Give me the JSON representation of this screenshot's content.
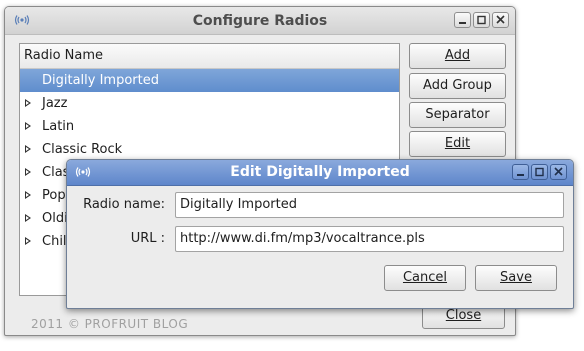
{
  "main_window": {
    "title": "Configure Radios",
    "list_header": "Radio Name",
    "rows": [
      {
        "label": "Digitally Imported",
        "expandable": false,
        "selected": true
      },
      {
        "label": "Jazz",
        "expandable": true,
        "selected": false
      },
      {
        "label": "Latin",
        "expandable": true,
        "selected": false
      },
      {
        "label": "Classic Rock",
        "expandable": true,
        "selected": false
      },
      {
        "label": "Clas",
        "expandable": true,
        "selected": false
      },
      {
        "label": "Pop",
        "expandable": true,
        "selected": false
      },
      {
        "label": "Oldi",
        "expandable": true,
        "selected": false
      },
      {
        "label": "Chil",
        "expandable": true,
        "selected": false
      }
    ],
    "buttons": {
      "add": "Add",
      "add_group": "Add Group",
      "separator": "Separator",
      "edit": "Edit",
      "close": "Close"
    },
    "watermark": "2011 © PROFRUIT BLOG"
  },
  "dialog": {
    "title": "Edit Digitally Imported",
    "radio_name_label": "Radio name:",
    "radio_name_value": "Digitally Imported",
    "url_label": "URL :",
    "url_value": "http://www.di.fm/mp3/vocaltrance.pls",
    "cancel": "Cancel",
    "save": "Save"
  },
  "colors": {
    "selection": "#6f99d3",
    "dialog_titlebar": "#5e86cb"
  }
}
